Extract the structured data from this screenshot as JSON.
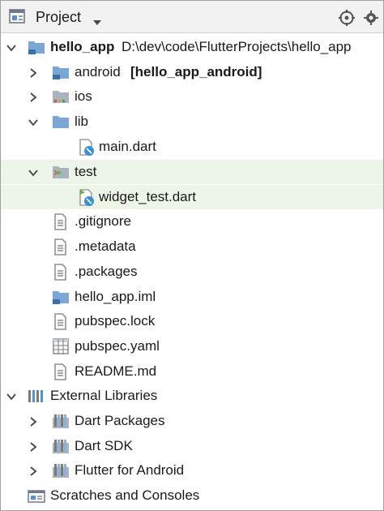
{
  "header": {
    "title": "Project",
    "project_icon": "project-view-icon",
    "dropdown_icon": "dropdown-arrow-icon",
    "locate_icon": "target-icon",
    "settings_icon": "settings-icon"
  },
  "tree": {
    "root": {
      "name": "hello_app",
      "path": "D:\\dev\\code\\FlutterProjects\\hello_app",
      "expanded": true
    },
    "android": {
      "name": "android",
      "module": "[hello_app_android]",
      "expanded": false
    },
    "ios": {
      "name": "ios",
      "expanded": false
    },
    "lib": {
      "name": "lib",
      "expanded": true
    },
    "main_dart": {
      "name": "main.dart"
    },
    "test": {
      "name": "test",
      "expanded": true
    },
    "widget_test": {
      "name": "widget_test.dart"
    },
    "gitignore": {
      "name": ".gitignore"
    },
    "metadata": {
      "name": ".metadata"
    },
    "packages": {
      "name": ".packages"
    },
    "iml": {
      "name": "hello_app.iml"
    },
    "pubspec_lock": {
      "name": "pubspec.lock"
    },
    "pubspec_yaml": {
      "name": "pubspec.yaml"
    },
    "readme": {
      "name": "README.md"
    },
    "external_libraries": {
      "name": "External Libraries",
      "expanded": true
    },
    "dart_packages": {
      "name": "Dart Packages",
      "expanded": false
    },
    "dart_sdk": {
      "name": "Dart SDK",
      "expanded": false
    },
    "flutter_android": {
      "name": "Flutter for Android",
      "expanded": false
    },
    "scratches": {
      "name": "Scratches and Consoles"
    }
  },
  "colors": {
    "folder": "#7aa7d6",
    "folder_dark": "#5b8fc7",
    "highlight_row": "#edf5e9",
    "path_text": "#7a7a7a",
    "dart_blue": "#3d8fd1",
    "test_green": "#62b543"
  }
}
